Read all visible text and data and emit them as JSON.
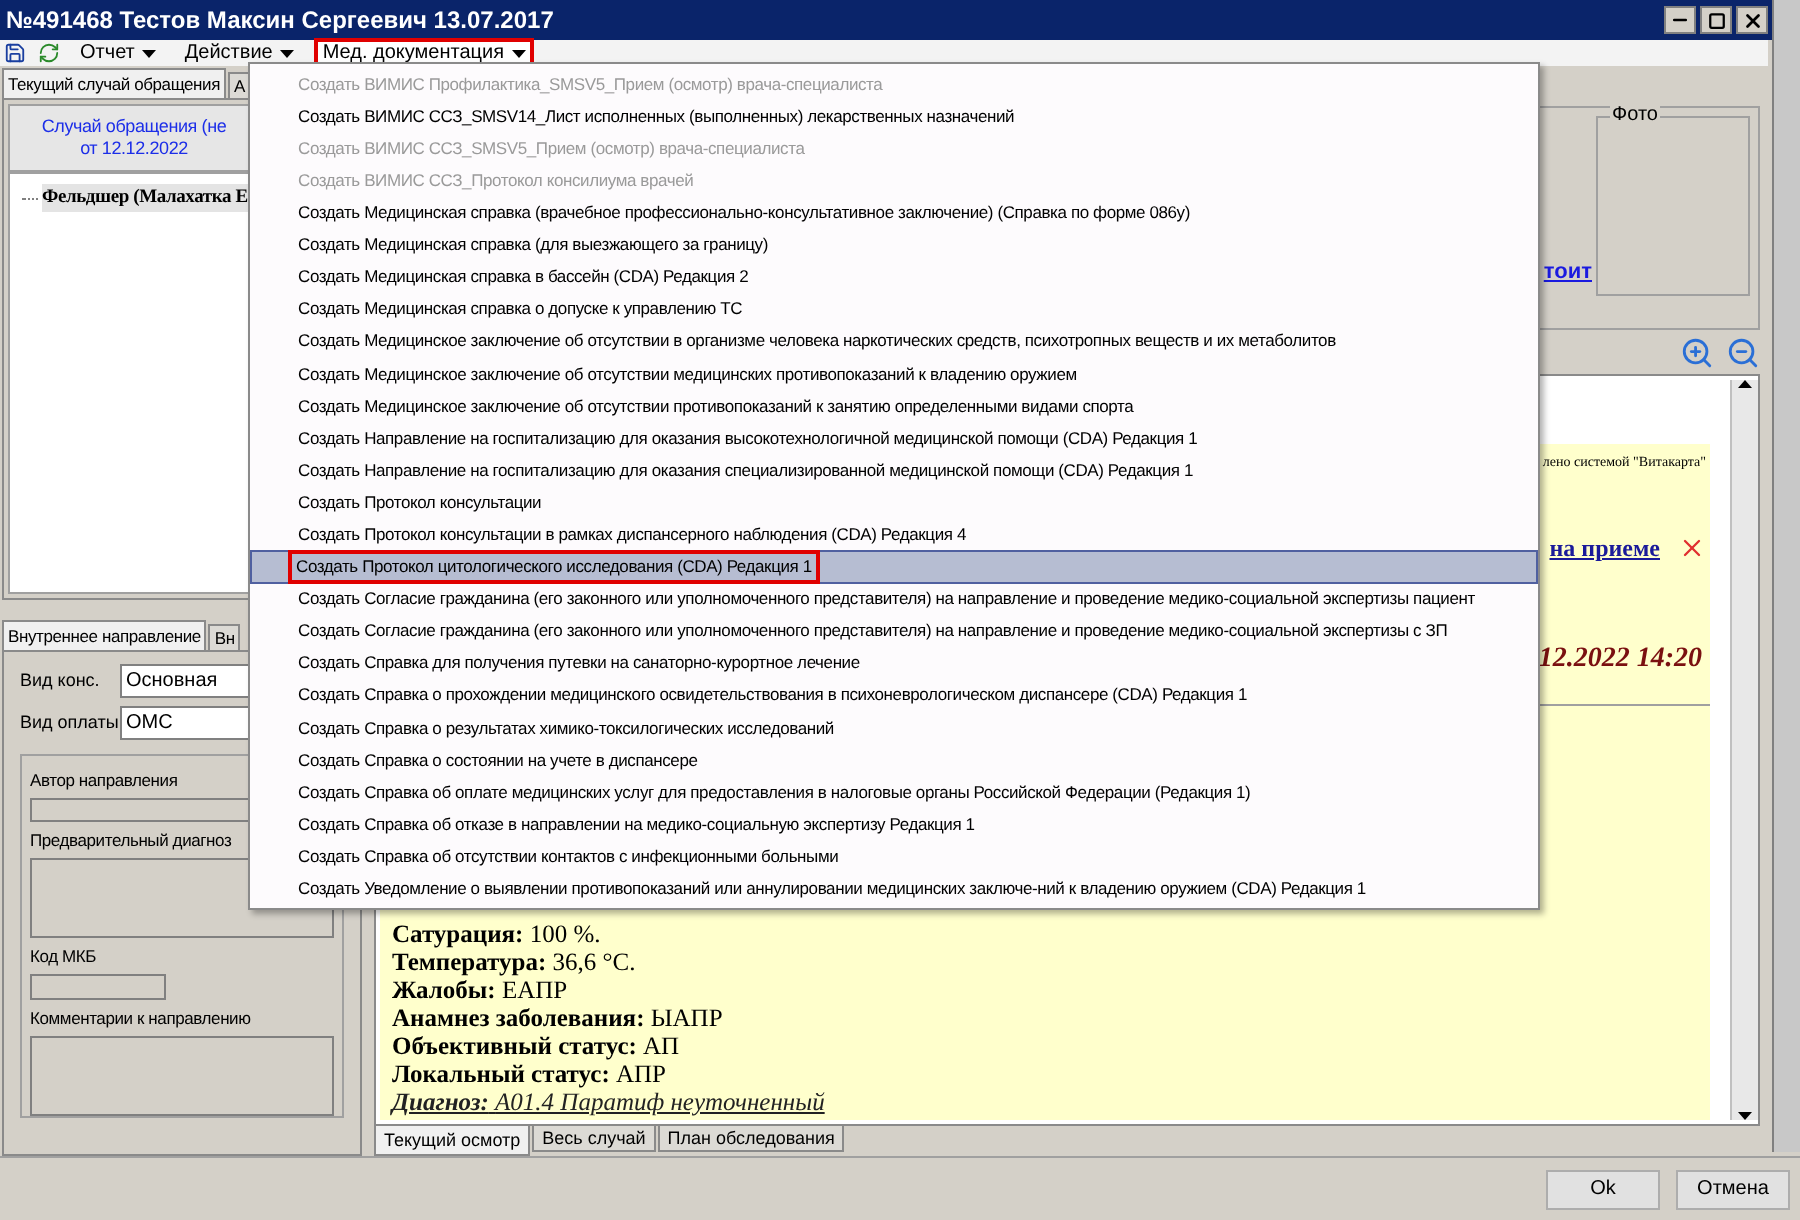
{
  "window": {
    "title": "№491468 Тестов Максин Сергеевич 13.07.2017"
  },
  "toolbar": {
    "menus": [
      {
        "label": "Отчет",
        "open": false
      },
      {
        "label": "Действие",
        "open": false
      },
      {
        "label": "Мед. документация",
        "open": true
      }
    ]
  },
  "dropdown": {
    "items": [
      {
        "label": "Создать ВИМИС Профилактика_SMSV5_Прием (осмотр) врача-специалиста",
        "disabled": true,
        "selected": false
      },
      {
        "label": "Создать ВИМИС ССЗ_SMSV14_Лист исполненных (выполненных) лекарственных назначений",
        "disabled": false,
        "selected": false
      },
      {
        "label": "Создать ВИМИС ССЗ_SMSV5_Прием (осмотр) врача-специалиста",
        "disabled": true,
        "selected": false
      },
      {
        "label": "Создать ВИМИС ССЗ_Протокол консилиума врачей",
        "disabled": true,
        "selected": false
      },
      {
        "label": "Создать Медицинская справка (врачебное профессионально-консультативное заключение) (Справка по форме 086у)",
        "disabled": false,
        "selected": false
      },
      {
        "label": "Создать Медицинская справка (для выезжающего за границу)",
        "disabled": false,
        "selected": false
      },
      {
        "label": "Создать Медицинская справка в бассейн (CDA) Редакция 2",
        "disabled": false,
        "selected": false
      },
      {
        "label": "Создать Медицинская справка о допуске к управлению ТС",
        "disabled": false,
        "selected": false
      },
      {
        "label": "Создать Медицинское заключение об отсутствии в организме человека наркотических средств, психотропных веществ и их метаболитов",
        "disabled": false,
        "selected": false
      },
      {
        "label": "Создать Медицинское заключение об отсутствии медицинских противопоказаний к владению оружием",
        "disabled": false,
        "selected": false
      },
      {
        "label": "Создать Медицинское заключение об отсутствии противопоказаний к занятию определенными видами спорта",
        "disabled": false,
        "selected": false
      },
      {
        "label": "Создать Направление на госпитализацию для оказания высокотехнологичной медицинской помощи (CDA) Редакция 1",
        "disabled": false,
        "selected": false
      },
      {
        "label": "Создать Направление на госпитализацию для оказания специализированной медицинской помощи (CDA) Редакция 1",
        "disabled": false,
        "selected": false
      },
      {
        "label": "Создать Протокол консультации",
        "disabled": false,
        "selected": false
      },
      {
        "label": "Создать Протокол консультации в рамках диспансерного наблюдения (CDA) Редакция 4",
        "disabled": false,
        "selected": false
      },
      {
        "label": "Создать Протокол цитологического исследования (CDA) Редакция 1",
        "disabled": false,
        "selected": true
      },
      {
        "label": "Создать Согласие гражданина (его законного или уполномоченного представителя) на направление и проведение медико-социальной экспертизы пациент",
        "disabled": false,
        "selected": false
      },
      {
        "label": "Создать Согласие гражданина (его законного или уполномоченного представителя) на направление и проведение медико-социальной экспертизы с ЗП",
        "disabled": false,
        "selected": false
      },
      {
        "label": "Создать Справка для получения путевки на санаторно-курортное лечение",
        "disabled": false,
        "selected": false
      },
      {
        "label": "Создать Справка о прохождении медицинского освидетельствования в психоневрологическом диспансере (CDA) Редакция 1",
        "disabled": false,
        "selected": false
      },
      {
        "label": "Создать Справка о результатах химико-токсилогических исследований",
        "disabled": false,
        "selected": false
      },
      {
        "label": "Создать Справка о состоянии на учете в диспансере",
        "disabled": false,
        "selected": false
      },
      {
        "label": "Создать Справка об оплате медицинских услуг для предоставления в налоговые органы Российской Федерации (Редакция 1)",
        "disabled": false,
        "selected": false
      },
      {
        "label": "Создать Справка об отказе в направлении на медико-социальную экспертизу Редакция 1",
        "disabled": false,
        "selected": false
      },
      {
        "label": "Создать Справка об отсутствии контактов с инфекционными больными",
        "disabled": false,
        "selected": false
      },
      {
        "label": "Создать Уведомление о выявлении противопоказаний или аннулировании медицинских заключе-ний к владению оружием (CDA) Редакция 1",
        "disabled": false,
        "selected": false
      }
    ]
  },
  "case_panel": {
    "tabs": [
      {
        "label": "Текущий случай обращения",
        "selected": true
      },
      {
        "label": "А",
        "selected": false
      }
    ],
    "header": [
      "Случай обращения (не",
      "от 12.12.2022"
    ],
    "tree": [
      "Фельдшер (Малахатка Е"
    ]
  },
  "referral_panel": {
    "tabs": [
      {
        "label": "Внутреннее направление",
        "selected": true
      },
      {
        "label": "Вн",
        "selected": false
      }
    ],
    "fields": [
      {
        "label": "Вид конс.",
        "value": "Основная"
      },
      {
        "label": "Вид оплаты",
        "value": "ОМС"
      }
    ],
    "group": [
      {
        "label": "Автор направления",
        "kind": "line"
      },
      {
        "label": "Предварительный диагноз",
        "kind": "area"
      },
      {
        "label": "Код МКБ",
        "kind": "short"
      },
      {
        "label": "Комментарии к направлению",
        "kind": "area"
      }
    ]
  },
  "patient": {
    "photo_label": "Фото",
    "link": "тоит"
  },
  "document": {
    "note": "лено системой \"Витакарта\"",
    "link": "на приеме",
    "date": "12.2022 14:20",
    "lines": [
      {
        "kind": "field",
        "label": "Сатурация:",
        "value": "100 %."
      },
      {
        "kind": "field",
        "label": "Температура:",
        "value": "36,6 °С."
      },
      {
        "kind": "field",
        "label": "Жалобы:",
        "value": "ЕАПР"
      },
      {
        "kind": "field",
        "label": "Анамнез заболевания:",
        "value": "ЫАПР"
      },
      {
        "kind": "field",
        "label": "Объективный статус:",
        "value": "АП"
      },
      {
        "kind": "field",
        "label": "Локальный статус:",
        "value": "АПР"
      },
      {
        "kind": "diagnosis",
        "label": "Диагноз:",
        "value": "A01.4 Паратиф неуточненный"
      }
    ]
  },
  "bottom_tabs": [
    {
      "label": "Текущий осмотр",
      "selected": true
    },
    {
      "label": "Весь случай",
      "selected": false
    },
    {
      "label": "План обследования",
      "selected": false
    }
  ],
  "buttons": [
    "Ok",
    "Отмена"
  ]
}
